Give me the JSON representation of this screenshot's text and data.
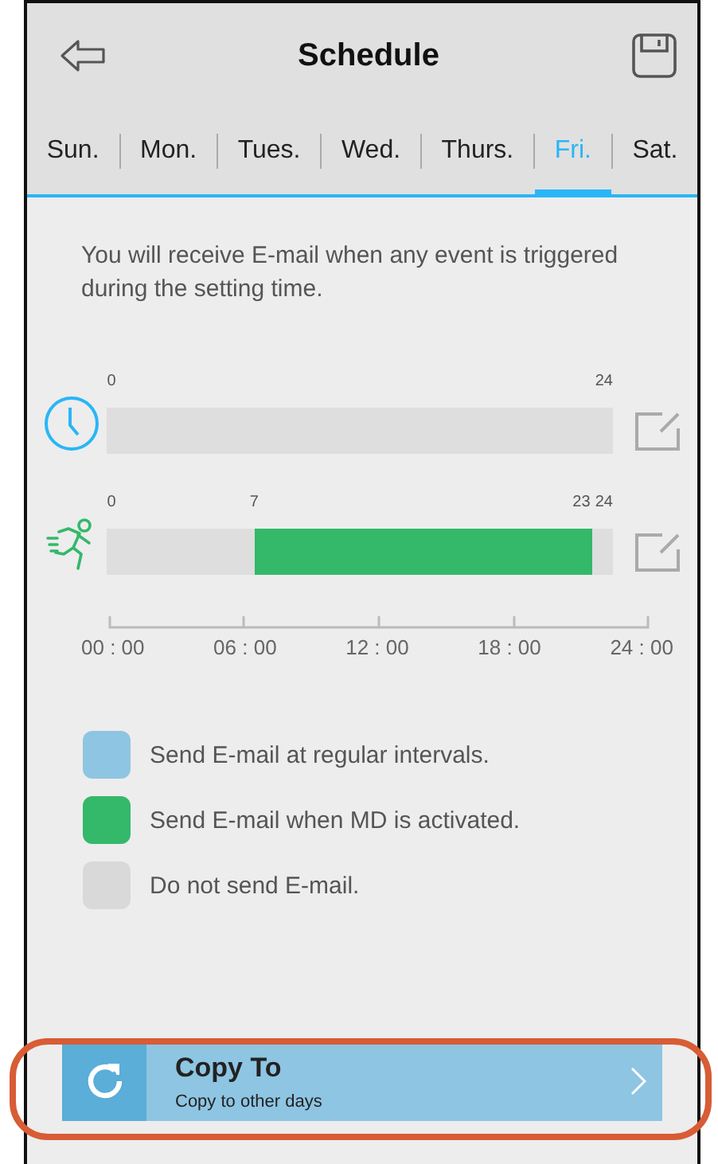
{
  "header": {
    "title": "Schedule"
  },
  "tabs": [
    {
      "label": "Sun.",
      "selected": false
    },
    {
      "label": "Mon.",
      "selected": false
    },
    {
      "label": "Tues.",
      "selected": false
    },
    {
      "label": "Wed.",
      "selected": false
    },
    {
      "label": "Thurs.",
      "selected": false
    },
    {
      "label": "Fri.",
      "selected": true
    },
    {
      "label": "Sat.",
      "selected": false
    }
  ],
  "description": "You will receive E-mail when any event is triggered during the setting time.",
  "schedules": [
    {
      "kind": "timer",
      "ticks": [
        "0",
        "24"
      ]
    },
    {
      "kind": "motion",
      "ticks": [
        "0",
        "24"
      ],
      "segments": [
        {
          "start": "7",
          "end": "23",
          "color": "#34b86a"
        }
      ]
    }
  ],
  "axis_labels": [
    "00 : 00",
    "06 : 00",
    "12 : 00",
    "18 : 00",
    "24 : 00"
  ],
  "legend": [
    {
      "label": "Send E-mail at regular intervals.",
      "color": "#8ec5e2"
    },
    {
      "label": "Send E-mail when MD is activated.",
      "color": "#34b86a"
    },
    {
      "label": "Do not send E-mail.",
      "color": "#d9d9d9"
    }
  ],
  "copy_button": {
    "title": "Copy To",
    "subtitle": "Copy to other days"
  }
}
